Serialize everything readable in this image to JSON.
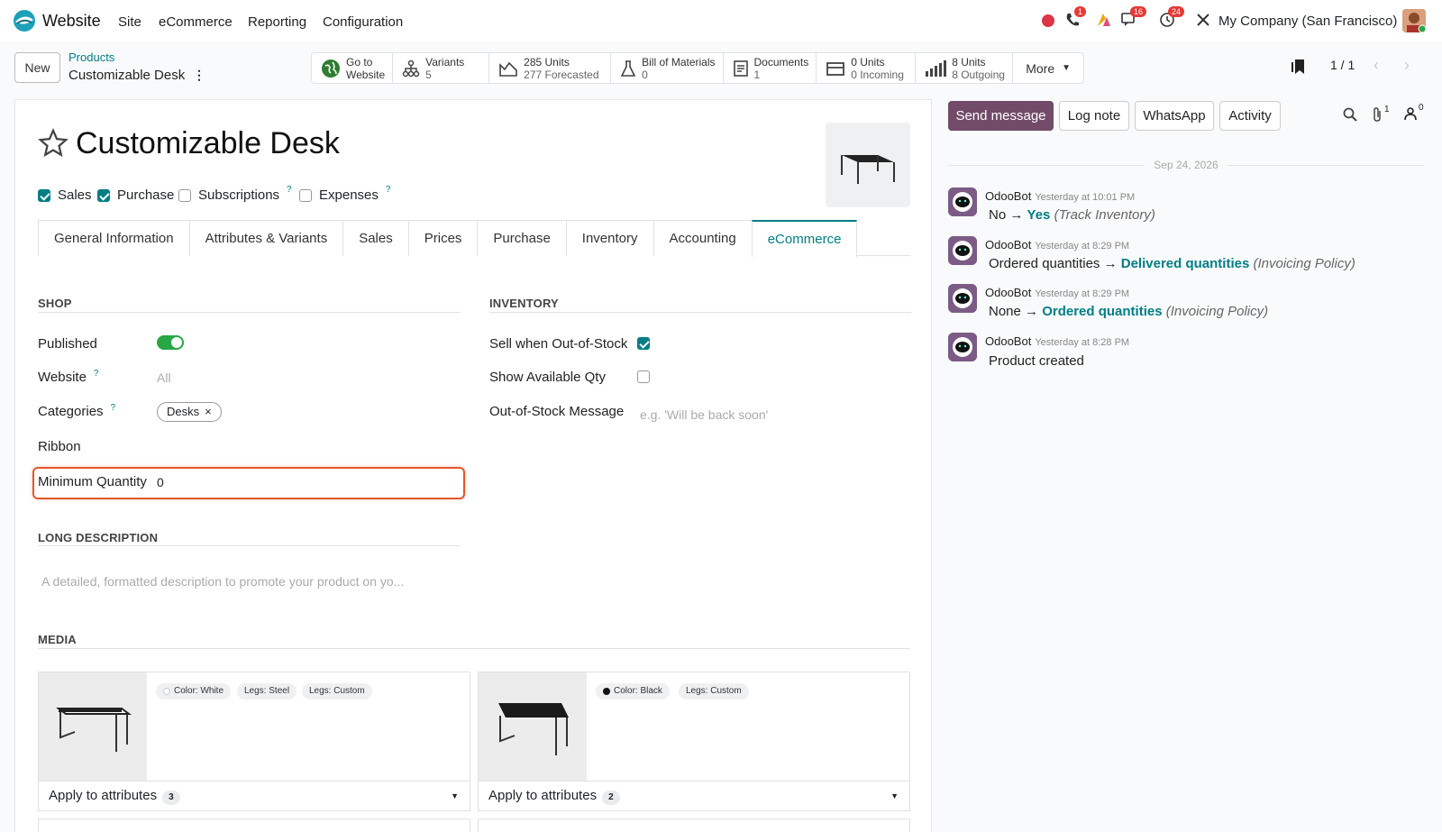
{
  "topnav": {
    "app_name": "Website",
    "menu": [
      "Site",
      "eCommerce",
      "Reporting",
      "Configuration"
    ],
    "badges": {
      "phone": "1",
      "chat": "16",
      "activity": "24"
    },
    "company": "My Company (San Francisco)"
  },
  "control": {
    "new_label": "New",
    "breadcrumb_parent": "Products",
    "breadcrumb_current": "Customizable Desk",
    "stats": [
      {
        "icon": "globe-icon",
        "line1": "Go to",
        "line2": "Website"
      },
      {
        "icon": "variants-icon",
        "line1": "Variants",
        "line2": "5"
      },
      {
        "icon": "forecast-chart-icon",
        "line1": "285 Units",
        "line2": "277 Forecasted"
      },
      {
        "icon": "flask-icon",
        "line1": "Bill of Materials",
        "line2": "0"
      },
      {
        "icon": "document-icon",
        "line1": "Documents",
        "line2": "1"
      },
      {
        "icon": "incoming-icon",
        "line1": "0 Units",
        "line2": "0 Incoming"
      },
      {
        "icon": "outgoing-bars-icon",
        "line1": "8 Units",
        "line2": "8 Outgoing"
      }
    ],
    "more_label": "More",
    "pager": "1 / 1"
  },
  "form": {
    "title": "Customizable Desk",
    "flags": [
      {
        "label": "Sales",
        "checked": true
      },
      {
        "label": "Purchase",
        "checked": true
      },
      {
        "label": "Subscriptions",
        "checked": false,
        "help": "?"
      },
      {
        "label": "Expenses",
        "checked": false,
        "help": "?"
      }
    ],
    "tabs": [
      "General Information",
      "Attributes & Variants",
      "Sales",
      "Prices",
      "Purchase",
      "Inventory",
      "Accounting",
      "eCommerce"
    ],
    "active_tab": "eCommerce",
    "shop": {
      "heading": "SHOP",
      "published_label": "Published",
      "published": true,
      "website_label": "Website",
      "website_placeholder": "All",
      "categories_label": "Categories",
      "category_tag": "Desks",
      "ribbon_label": "Ribbon",
      "min_qty_label": "Minimum Quantity",
      "min_qty_value": "0"
    },
    "inventory": {
      "heading": "INVENTORY",
      "sell_oos_label": "Sell when Out-of-Stock",
      "sell_oos": true,
      "show_qty_label": "Show Available Qty",
      "show_qty": false,
      "oos_msg_label": "Out-of-Stock Message",
      "oos_msg_placeholder": "e.g. 'Will be back soon'"
    },
    "long_description": {
      "heading": "LONG DESCRIPTION",
      "placeholder": "A detailed, formatted description to promote your product on yo..."
    },
    "media": {
      "heading": "MEDIA",
      "cards": [
        {
          "chips": [
            "Color: White",
            "Legs: Steel",
            "Legs: Custom"
          ],
          "footer": "Apply to attributes",
          "count": "3"
        },
        {
          "chips": [
            "Color: Black",
            "Legs: Custom"
          ],
          "footer": "Apply to attributes",
          "count": "2"
        }
      ]
    }
  },
  "chatter": {
    "send_message": "Send message",
    "log_note": "Log note",
    "whatsapp": "WhatsApp",
    "activity": "Activity",
    "attachments_count": "1",
    "followers_count": "0",
    "date": "Sep 24, 2026",
    "messages": [
      {
        "author": "OdooBot",
        "time": "Yesterday at 10:01 PM",
        "old": "No",
        "arrow": "→",
        "new": "Yes",
        "field": "(Track Inventory)"
      },
      {
        "author": "OdooBot",
        "time": "Yesterday at 8:29 PM",
        "old": "Ordered quantities",
        "arrow": "→",
        "new": "Delivered quantities",
        "field": "(Invoicing Policy)"
      },
      {
        "author": "OdooBot",
        "time": "Yesterday at 8:29 PM",
        "old": "None",
        "arrow": "→",
        "new": "Ordered quantities",
        "field": "(Invoicing Policy)"
      },
      {
        "author": "OdooBot",
        "time": "Yesterday at 8:28 PM",
        "text": "Product created"
      }
    ]
  }
}
